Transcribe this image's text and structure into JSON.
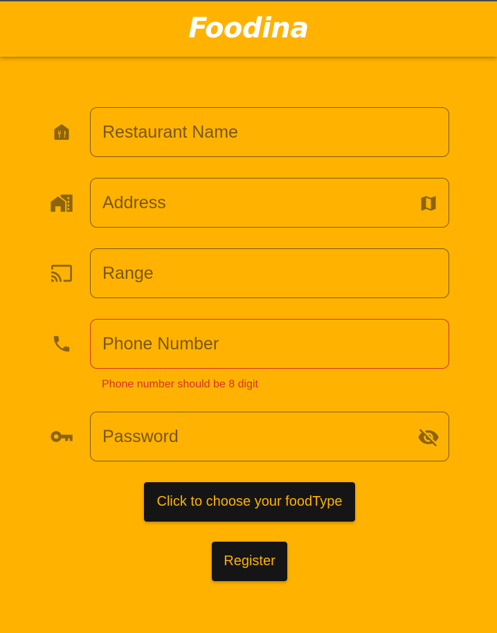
{
  "app": {
    "title": "Foodina"
  },
  "form": {
    "restaurant_name": {
      "placeholder": "Restaurant Name",
      "value": "",
      "icon": "storefront-icon"
    },
    "address": {
      "placeholder": "Address",
      "value": "",
      "icon": "home-work-icon",
      "trailing_icon": "map-icon"
    },
    "range": {
      "placeholder": "Range",
      "value": "",
      "icon": "cast-icon"
    },
    "phone": {
      "placeholder": "Phone Number",
      "value": "",
      "icon": "phone-icon",
      "error": "Phone number should be 8 digit"
    },
    "password": {
      "placeholder": "Password",
      "value": "",
      "icon": "key-icon",
      "trailing_icon": "visibility-off-icon"
    }
  },
  "buttons": {
    "food_type": "Click to choose your foodType",
    "register": "Register"
  },
  "colors": {
    "background": "#FFB300",
    "icon": "#8C6410",
    "error": "#D32F2F",
    "button_bg": "#151515",
    "button_text": "#FFB300"
  }
}
